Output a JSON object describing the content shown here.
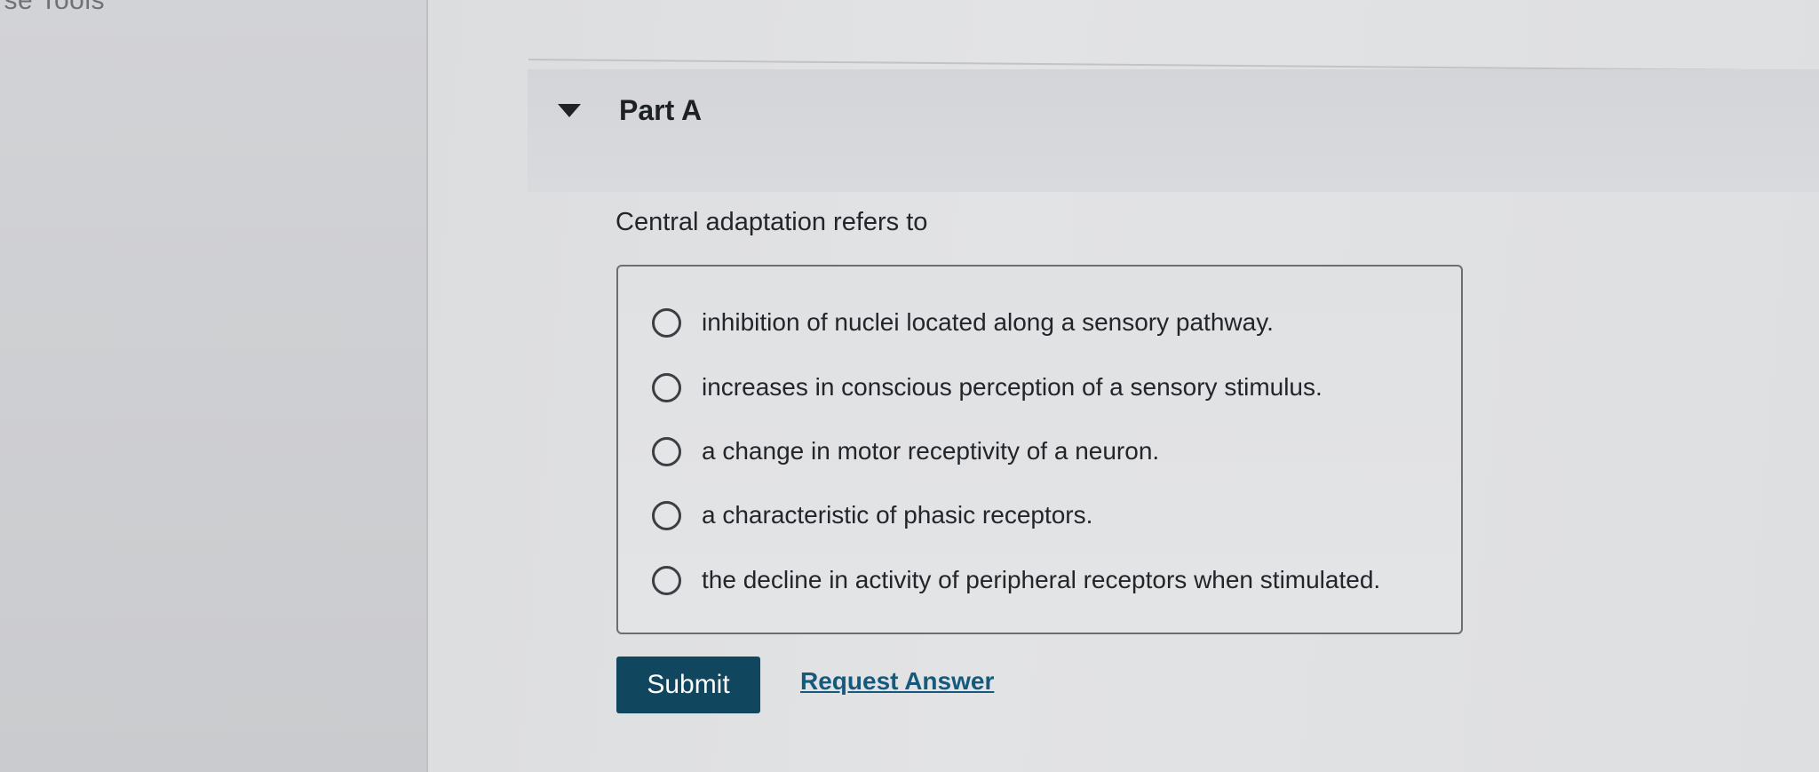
{
  "sidebar": {
    "tools_label": "rse Tools"
  },
  "part": {
    "title": "Part A",
    "expanded_icon": "caret-down-icon"
  },
  "question": {
    "prompt": "Central adaptation refers to",
    "choices": [
      {
        "label": "inhibition of nuclei located along a sensory pathway.",
        "selected": false
      },
      {
        "label": "increases in conscious perception of a sensory stimulus.",
        "selected": false
      },
      {
        "label": "a change in motor receptivity of a neuron.",
        "selected": false
      },
      {
        "label": "a characteristic of phasic receptors.",
        "selected": false
      },
      {
        "label": "the decline in activity of peripheral receptors when stimulated.",
        "selected": false
      }
    ]
  },
  "actions": {
    "submit_label": "Submit",
    "request_answer_label": "Request Answer"
  },
  "colors": {
    "submit_bg": "#11465f",
    "link": "#155a7d"
  }
}
